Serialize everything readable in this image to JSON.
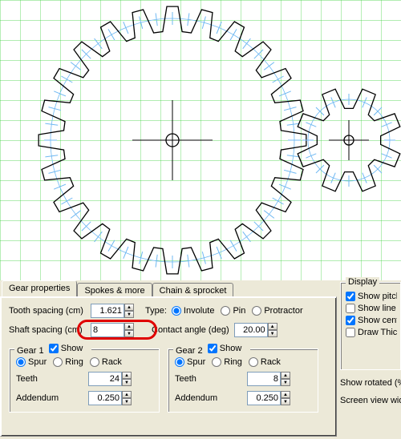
{
  "tabs": {
    "gear_properties": "Gear properties",
    "spokes_more": "Spokes & more",
    "chain_sprocket": "Chain & sprocket"
  },
  "tooth_spacing": {
    "label": "Tooth spacing (cm)",
    "value": "1.621"
  },
  "shaft_spacing": {
    "label": "Shaft spacing (cm)",
    "value": "8"
  },
  "type_label": "Type:",
  "type_options": {
    "involute": "Involute",
    "pin": "Pin",
    "protractor": "Protractor"
  },
  "contact_angle": {
    "label": "Contact angle (deg)",
    "value": "20.00"
  },
  "gear1": {
    "title": "Gear 1",
    "show": "Show",
    "spur": "Spur",
    "ring": "Ring",
    "rack": "Rack",
    "teeth_label": "Teeth",
    "teeth_value": "24",
    "addendum_label": "Addendum",
    "addendum_value": "0.250"
  },
  "gear2": {
    "title": "Gear 2",
    "show": "Show",
    "spur": "Spur",
    "ring": "Ring",
    "rack": "Rack",
    "teeth_label": "Teeth",
    "teeth_value": "8",
    "addendum_label": "Addendum",
    "addendum_value": "0.250"
  },
  "display": {
    "title": "Display",
    "pitch": "Show pitch d",
    "line": "Show line of c",
    "center": "Show center",
    "thicker": "Draw Thicker"
  },
  "show_rotated": "Show rotated (% o",
  "screen_view": "Screen view widtl"
}
